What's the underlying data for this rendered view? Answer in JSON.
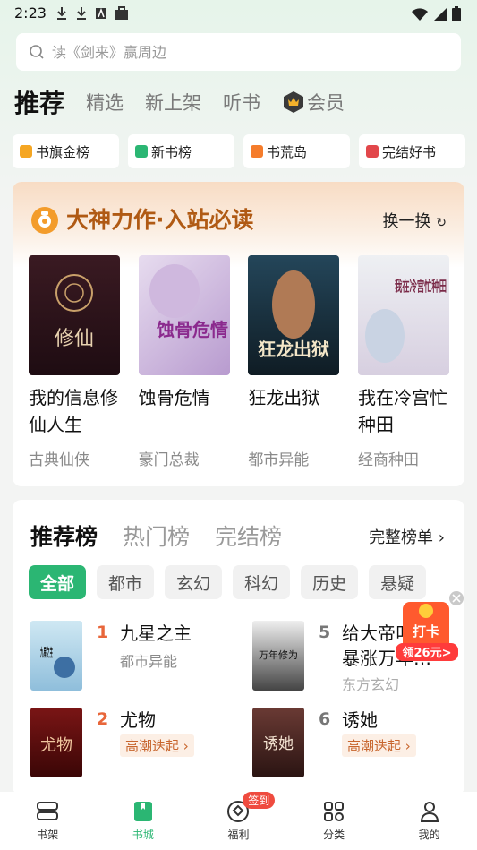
{
  "status_bar": {
    "time": "2:23"
  },
  "search": {
    "placeholder": "读《剑来》赢周边"
  },
  "top_tabs": [
    {
      "label": "推荐",
      "active": true
    },
    {
      "label": "精选"
    },
    {
      "label": "新上架"
    },
    {
      "label": "听书"
    },
    {
      "label": "会员"
    }
  ],
  "quick_entries": [
    {
      "label": "书旗金榜",
      "color": "#f5a623"
    },
    {
      "label": "新书榜",
      "color": "#2bb673"
    },
    {
      "label": "书荒岛",
      "color": "#f57c2b"
    },
    {
      "label": "完结好书",
      "color": "#e2474b"
    }
  ],
  "featured": {
    "title": "大神力作·入站必读",
    "switch_label": "换一换",
    "books": [
      {
        "title": "我的信息修仙人生",
        "category": "古典仙侠",
        "cover_text": "修仙",
        "cover_bg": "#3a1a22"
      },
      {
        "title": "蚀骨危情",
        "category": "豪门总裁",
        "cover_text": "蚀骨危情",
        "cover_bg": "#d7c9e6"
      },
      {
        "title": "狂龙出狱",
        "category": "都市异能",
        "cover_text": "狂龙出狱",
        "cover_bg": "#1c2f3a"
      },
      {
        "title": "我在冷宫忙种田",
        "category": "经商种田",
        "cover_text": "我在冷宫忙种田",
        "cover_bg": "#e8e4ec"
      }
    ]
  },
  "ranking": {
    "tabs": [
      {
        "label": "推荐榜",
        "active": true
      },
      {
        "label": "热门榜"
      },
      {
        "label": "完结榜"
      }
    ],
    "full_list_label": "完整榜单",
    "chips": [
      {
        "label": "全部",
        "active": true
      },
      {
        "label": "都市"
      },
      {
        "label": "玄幻"
      },
      {
        "label": "科幻"
      },
      {
        "label": "历史"
      },
      {
        "label": "悬疑"
      }
    ],
    "items": [
      {
        "rank": "1",
        "title": "九星之主",
        "sub": "都市异能",
        "cover_text": "九星之主",
        "cover_bg": "#bfe0ef"
      },
      {
        "rank": "5",
        "title": "给大帝叫…我暴涨万年…",
        "sub": "东方玄幻",
        "cover_text": "万年修为",
        "cover_bg": "#2a2a2a"
      },
      {
        "rank": "2",
        "title": "尤物",
        "tag": "高潮迭起",
        "cover_text": "尤物",
        "cover_bg": "#5a0e0e"
      },
      {
        "rank": "6",
        "title": "诱她",
        "tag": "高潮迭起",
        "cover_text": "诱她",
        "cover_bg": "#4a2a28"
      }
    ]
  },
  "float_badge": {
    "title": "打卡",
    "amount_label": "领26元>"
  },
  "bottom_nav": [
    {
      "label": "书架"
    },
    {
      "label": "书城",
      "active": true
    },
    {
      "label": "福利",
      "badge": "签到"
    },
    {
      "label": "分类"
    },
    {
      "label": "我的"
    }
  ]
}
